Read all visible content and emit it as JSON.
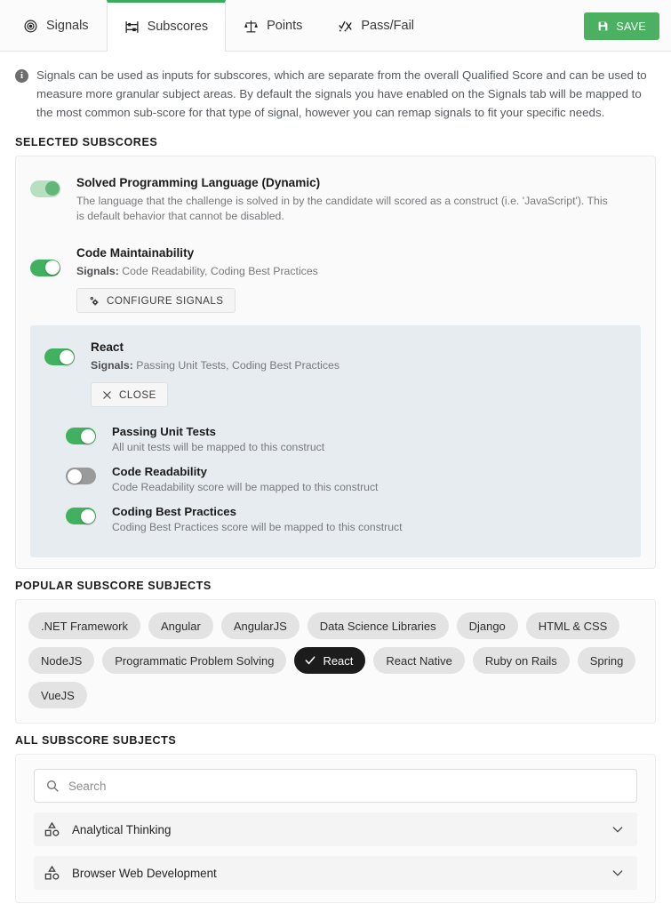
{
  "tabs": [
    {
      "id": "signals",
      "label": "Signals",
      "icon": "signal-radar-icon",
      "active": false
    },
    {
      "id": "subscores",
      "label": "Subscores",
      "icon": "abacus-icon",
      "active": true
    },
    {
      "id": "points",
      "label": "Points",
      "icon": "balance-scale-icon",
      "active": false
    },
    {
      "id": "passfail",
      "label": "Pass/Fail",
      "icon": "pass-fail-icon",
      "active": false
    }
  ],
  "toolbar": {
    "save_label": "SAVE",
    "save_icon": "floppy-disk-icon",
    "save_color": "#4bb062"
  },
  "info": {
    "icon": "info-circle-icon",
    "text": "Signals can be used as inputs for subscores, which are separate from the overall Qualified Score and can be used to measure more granular subject areas. By default the signals you have enabled on the Signals tab will be mapped to the most common sub-score for that type of signal, however you can remap signals to fit your specific needs."
  },
  "sections": {
    "selected_subscores_label": "SELECTED SUBSCORES",
    "popular_label": "POPULAR SUBSCORE SUBJECTS",
    "all_label": "ALL SUBSCORE SUBJECTS"
  },
  "subscores": [
    {
      "title": "Solved Programming Language (Dynamic)",
      "desc": "The language that the challenge is solved in by the candidate will scored as a construct (i.e. 'JavaScript'). This is default behavior that cannot be disabled.",
      "toggle_state": "on-disabled"
    },
    {
      "title": "Code Maintainability",
      "signals_label": "Signals:",
      "signals_value": " Code Readability, Coding Best Practices",
      "toggle_state": "on",
      "button_label": "CONFIGURE SIGNALS",
      "button_icon": "gears-icon"
    }
  ],
  "react_block": {
    "title": "React",
    "signals_label": "Signals:",
    "signals_value": " Passing Unit Tests, Coding Best Practices",
    "toggle_state": "on",
    "button_label": "CLOSE",
    "button_icon": "close-x-icon",
    "signals": [
      {
        "title": "Passing Unit Tests",
        "desc": "All unit tests will be mapped to this construct",
        "toggle_state": "on"
      },
      {
        "title": "Code Readability",
        "desc": "Code Readability score will be mapped to this construct",
        "toggle_state": "off"
      },
      {
        "title": "Coding Best Practices",
        "desc": "Coding Best Practices score will be mapped to this construct",
        "toggle_state": "on"
      }
    ]
  },
  "popular_chips": [
    {
      "label": ".NET Framework",
      "selected": false
    },
    {
      "label": "Angular",
      "selected": false
    },
    {
      "label": "AngularJS",
      "selected": false
    },
    {
      "label": "Data Science Libraries",
      "selected": false
    },
    {
      "label": "Django",
      "selected": false
    },
    {
      "label": "HTML & CSS",
      "selected": false
    },
    {
      "label": "NodeJS",
      "selected": false
    },
    {
      "label": "Programmatic Problem Solving",
      "selected": false
    },
    {
      "label": "React",
      "selected": true
    },
    {
      "label": "React Native",
      "selected": false
    },
    {
      "label": "Ruby on Rails",
      "selected": false
    },
    {
      "label": "Spring",
      "selected": false
    },
    {
      "label": "VueJS",
      "selected": false
    }
  ],
  "search": {
    "placeholder": "Search",
    "value": "",
    "icon": "search-icon"
  },
  "accordions": [
    {
      "label": "Analytical Thinking",
      "icon": "shapes-icon",
      "chevron": "chevron-down-icon"
    },
    {
      "label": "Browser Web Development",
      "icon": "shapes-icon",
      "chevron": "chevron-down-icon"
    }
  ]
}
